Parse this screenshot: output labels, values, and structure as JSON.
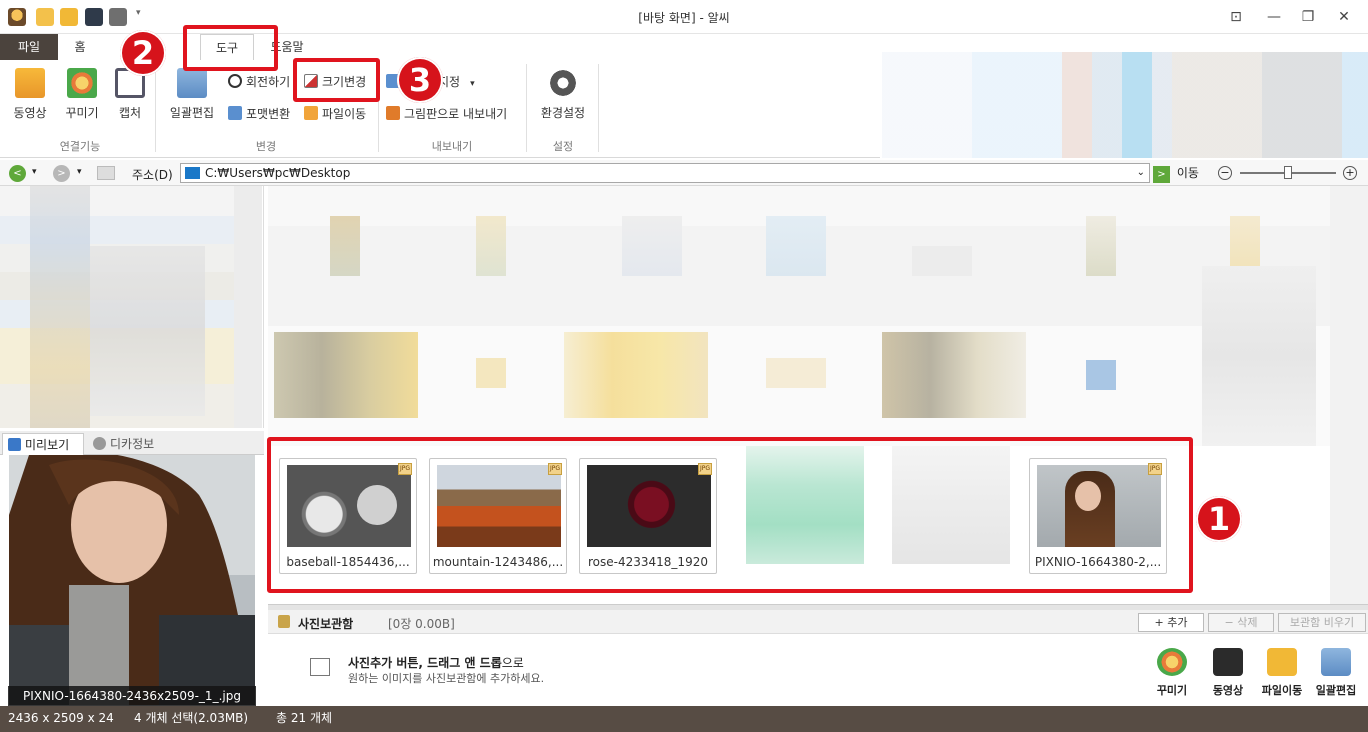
{
  "window": {
    "title": "[바탕 화면] - 알씨"
  },
  "menu_tabs": {
    "file": "파일",
    "home": "홈",
    "tools": "도구",
    "help": "도움말"
  },
  "ribbon": {
    "video": "동영상",
    "decorate": "꾸미기",
    "capture": "캡처",
    "batch_edit": "일괄편집",
    "rotate": "회전하기",
    "resize": "크기변경",
    "format_convert": "포맷변환",
    "file_move": "파일이동",
    "set_partial": "지정",
    "export_paint": "그림판으로 내보내기",
    "settings": "환경설정",
    "groups": {
      "connect": "연결기능",
      "change": "변경",
      "export": "내보내기",
      "setting": "설정"
    }
  },
  "address": {
    "label": "주소(D)",
    "path": "C:₩Users₩pc₩Desktop",
    "go": "이동"
  },
  "preview_tabs": {
    "preview": "미리보기",
    "camera_info": "디카정보"
  },
  "preview_caption": "PIXNIO-1664380-2436x2509-_1_.jpg",
  "thumbnails": [
    {
      "name": "baseball-1854436,..."
    },
    {
      "name": "mountain-1243486,..."
    },
    {
      "name": "rose-4233418_1920"
    },
    {
      "name": "PIXNIO-1664380-2,..."
    }
  ],
  "thumb_badge": "JPG",
  "annotations": {
    "one": "1",
    "two": "2",
    "three": "3"
  },
  "storage": {
    "title": "사진보관함",
    "count": "[0장 0.00B]",
    "add": "+ 추가",
    "delete": "− 삭제",
    "empty": "보관함 비우기",
    "hint_bold": "사진추가 버튼, 드래그 앤 드롭",
    "hint_suffix": "으로",
    "hint_line2": "원하는 이미지를 사진보관함에 추가하세요.",
    "actions": {
      "decorate": "꾸미기",
      "video": "동영상",
      "file_move": "파일이동",
      "batch_edit": "일괄편집"
    }
  },
  "status": {
    "dimensions": "2436 x 2509 x 24",
    "selection": "4 개체 선택(2.03MB)",
    "total": "총 21 개체"
  }
}
